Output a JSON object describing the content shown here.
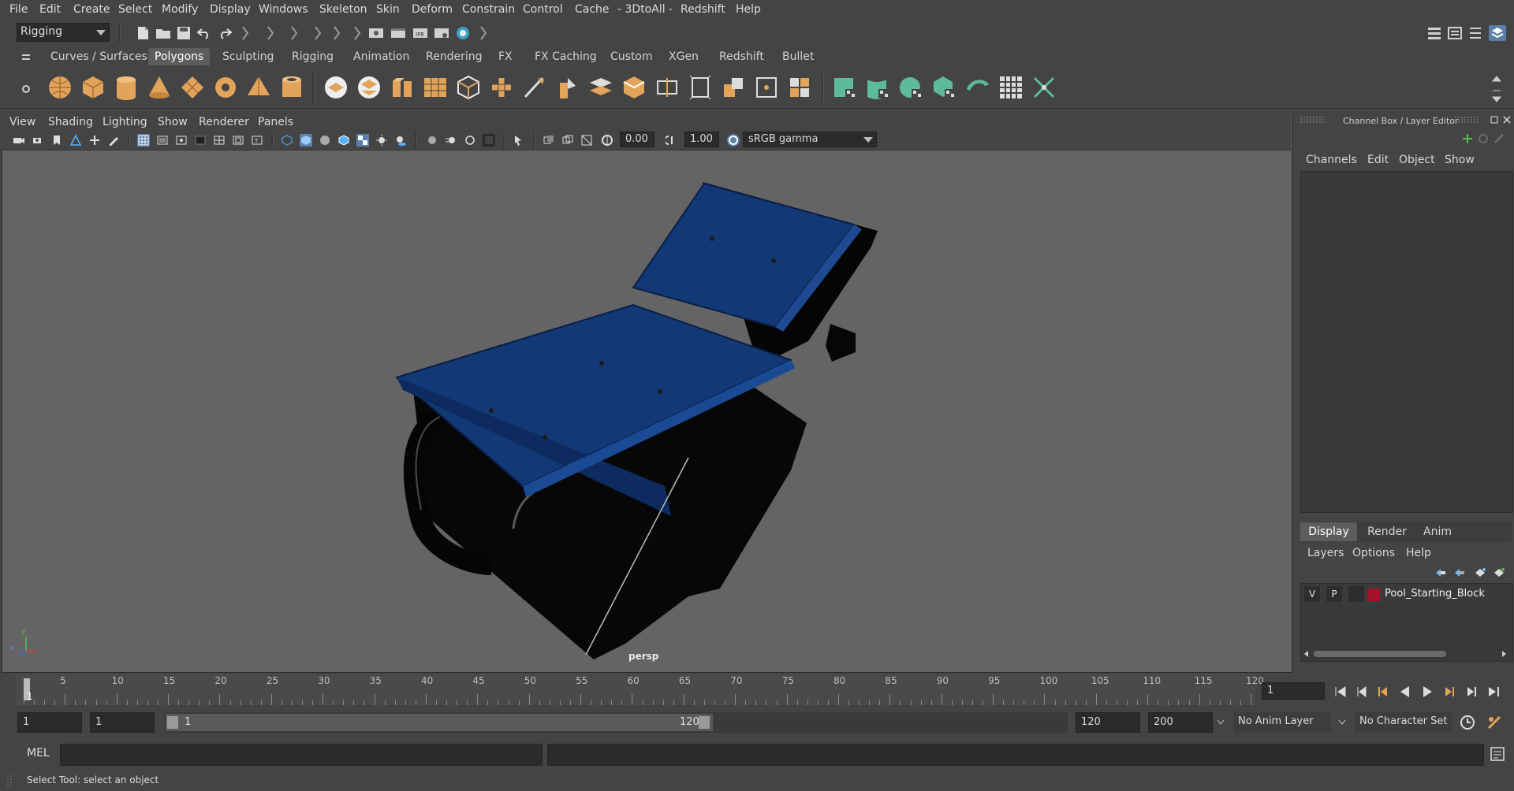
{
  "menubar": {
    "items": [
      "File",
      "Edit",
      "Create",
      "Select",
      "Modify",
      "Display",
      "Windows",
      "Skeleton",
      "Skin",
      "Deform",
      "Constrain",
      "Control",
      "Cache",
      "- 3DtoAll -",
      "Redshift",
      "Help"
    ]
  },
  "statusline": {
    "menuset": "Rigging"
  },
  "shelf": {
    "tabs": [
      "Curves / Surfaces",
      "Polygons",
      "Sculpting",
      "Rigging",
      "Animation",
      "Rendering",
      "FX",
      "FX Caching",
      "Custom",
      "XGen",
      "Redshift",
      "Bullet"
    ],
    "active_tab": "Polygons"
  },
  "viewport": {
    "menus": [
      "View",
      "Shading",
      "Lighting",
      "Show",
      "Renderer",
      "Panels"
    ],
    "exposure": "0.00",
    "gamma": "1.00",
    "colorspace": "sRGB gamma",
    "camera_label": "persp",
    "axis": {
      "x": "x",
      "y": "y",
      "z": "z"
    }
  },
  "channelbox": {
    "title": "Channel Box / Layer Editor",
    "menus": [
      "Channels",
      "Edit",
      "Object",
      "Show"
    ],
    "layer_tabs": [
      "Display",
      "Render",
      "Anim"
    ],
    "active_layer_tab": "Display",
    "layer_menus": [
      "Layers",
      "Options",
      "Help"
    ],
    "layer": {
      "v": "V",
      "p": "P",
      "name": "Pool_Starting_Block",
      "color": "#a3122a"
    }
  },
  "timeslider": {
    "labels": [
      "5",
      "10",
      "15",
      "20",
      "25",
      "30",
      "35",
      "40",
      "45",
      "50",
      "55",
      "60",
      "65",
      "70",
      "75",
      "80",
      "85",
      "90",
      "95",
      "100",
      "105",
      "110",
      "115",
      "120"
    ],
    "first": "1",
    "current_frame": "1"
  },
  "range": {
    "start": "1",
    "playback_start": "1",
    "slider_start": "1",
    "slider_end": "120",
    "playback_end": "120",
    "end": "200",
    "anim_layer": "No Anim Layer",
    "character_set": "No Character Set"
  },
  "cmdline": {
    "lang": "MEL"
  },
  "helpline": {
    "text": "Select Tool: select an object"
  },
  "colors": {
    "accent_teal": "#5dbb9a",
    "shelf_orange": "#e2a35a",
    "model_blue": "#123876"
  }
}
